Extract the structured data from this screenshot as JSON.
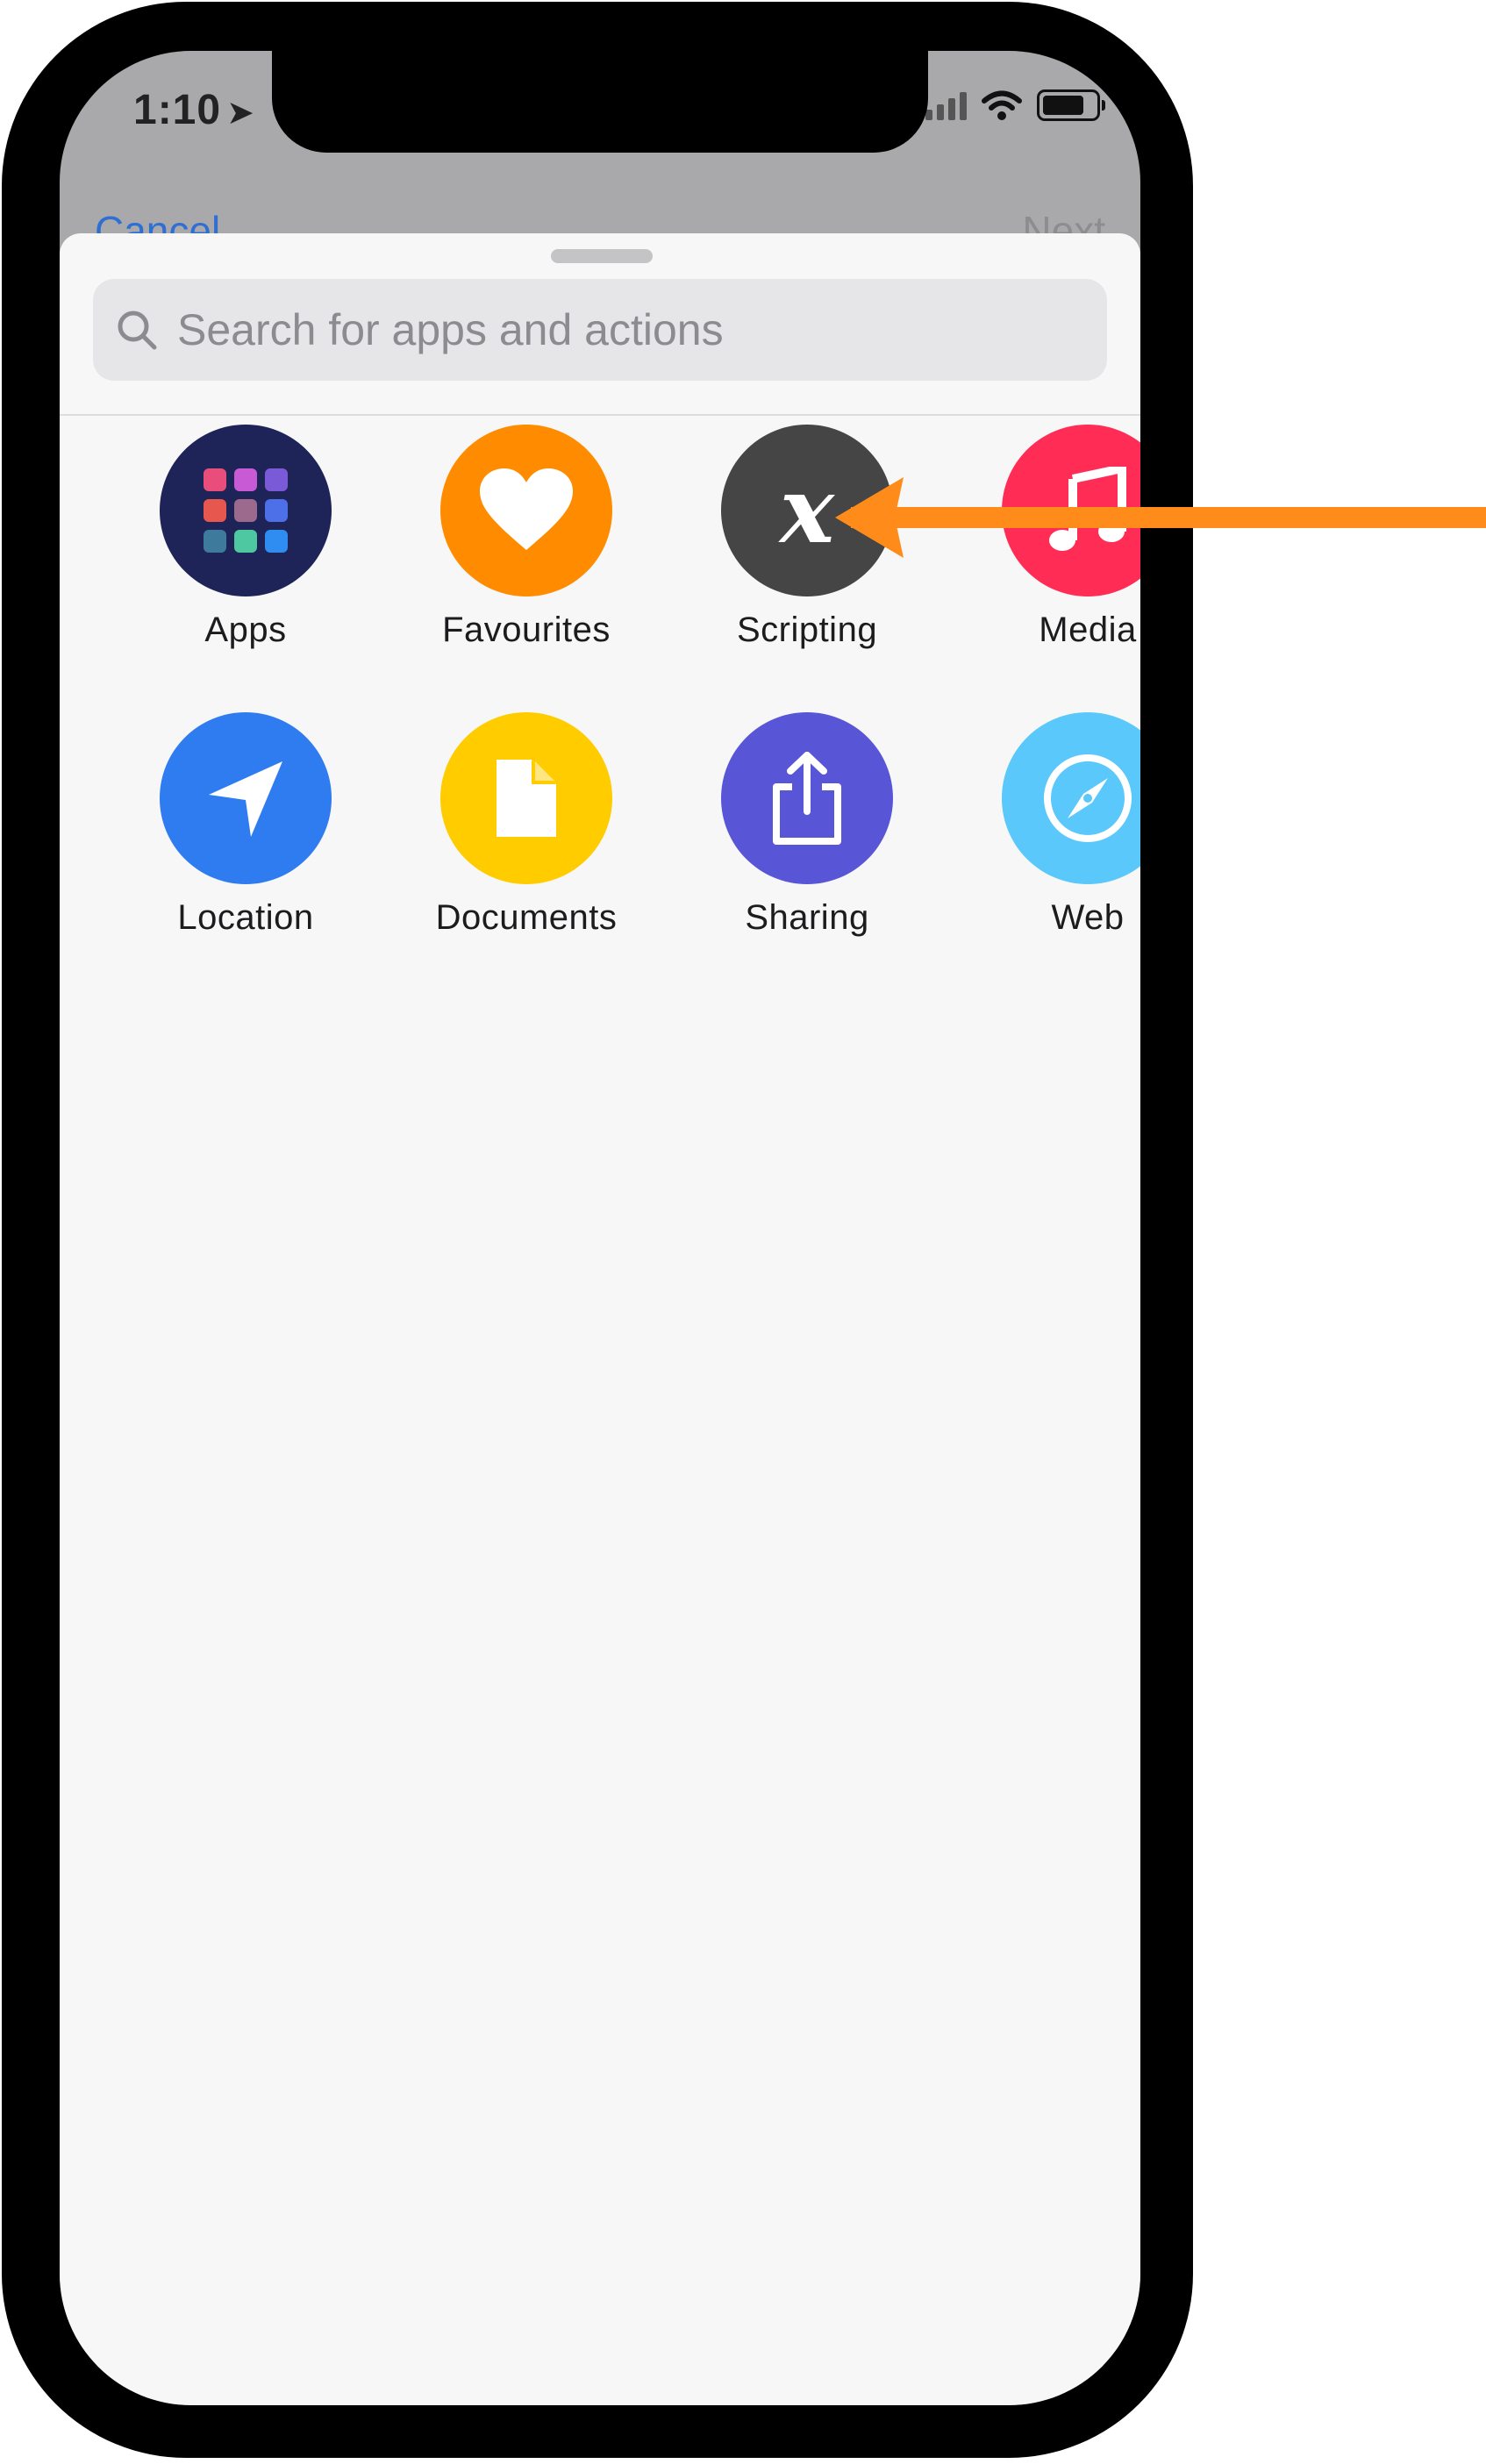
{
  "status_bar": {
    "time": "1:10"
  },
  "nav": {
    "cancel_label": "Cancel",
    "next_label": "Next"
  },
  "search": {
    "placeholder": "Search for apps and actions"
  },
  "categories": [
    {
      "label": "Apps",
      "icon": "apps-grid-icon",
      "color": "#1e2358"
    },
    {
      "label": "Favourites",
      "icon": "heart-icon",
      "color": "#ff8c00"
    },
    {
      "label": "Scripting",
      "icon": "variable-x-icon",
      "color": "#454545"
    },
    {
      "label": "Media",
      "icon": "music-note-icon",
      "color": "#ff2d55"
    },
    {
      "label": "Location",
      "icon": "location-arrow-icon",
      "color": "#2f7cf0"
    },
    {
      "label": "Documents",
      "icon": "document-icon",
      "color": "#ffcc00"
    },
    {
      "label": "Sharing",
      "icon": "share-icon",
      "color": "#5856d6"
    },
    {
      "label": "Web",
      "icon": "compass-icon",
      "color": "#5ac8fa"
    }
  ],
  "annotation": {
    "color": "#ff8c1a",
    "points_to": "Scripting"
  }
}
